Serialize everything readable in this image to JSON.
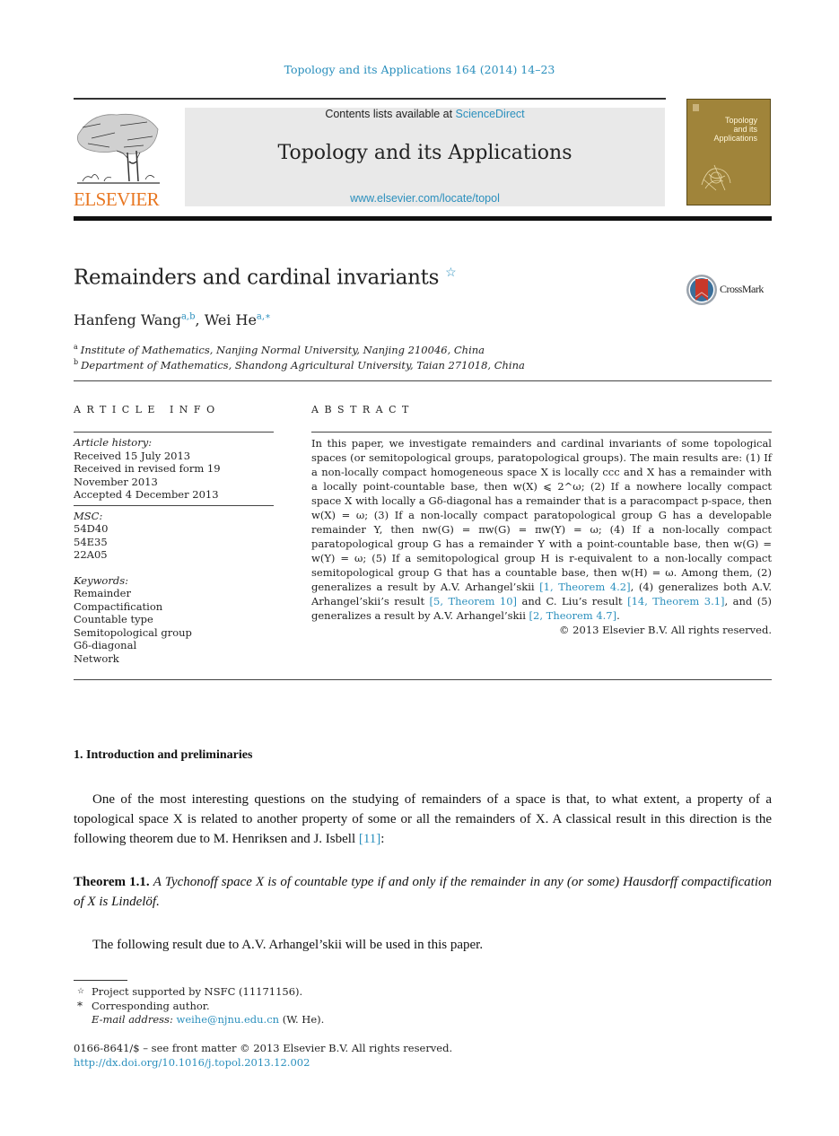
{
  "header": {
    "journal_ref": "Topology and its Applications 164 (2014) 14–23",
    "contents_prefix": "Contents lists available at ",
    "contents_link": "ScienceDirect",
    "journal_title": "Topology and its Applications",
    "journal_url": "www.elsevier.com/locate/topol",
    "publisher_logo_text": "ELSEVIER",
    "cover_title_lines": [
      "Topology",
      "and its",
      "Applications"
    ],
    "crossmark_label": "CrossMark"
  },
  "colors": {
    "link": "#2a8fbd",
    "elsevier_orange": "#e87722",
    "cover_gold": "#a0843a",
    "masthead_gray": "#e9e9e9"
  },
  "article": {
    "title": "Remainders and cardinal invariants",
    "title_mark": "☆",
    "authors": [
      {
        "name": "Hanfeng Wang",
        "marks": "a,b"
      },
      {
        "name": "Wei He",
        "marks": "a,∗"
      }
    ],
    "author_separator": ", ",
    "affiliations": [
      {
        "mark": "a",
        "text": "Institute of Mathematics, Nanjing Normal University, Nanjing 210046, China"
      },
      {
        "mark": "b",
        "text": "Department of Mathematics, Shandong Agricultural University, Taian 271018, China"
      }
    ]
  },
  "article_info": {
    "heading": "ARTICLE INFO",
    "history_label": "Article history:",
    "history": [
      "Received 15 July 2013",
      "Received in revised form 19",
      "November 2013",
      "Accepted 4 December 2013"
    ],
    "msc_label": "MSC:",
    "msc": [
      "54D40",
      "54E35",
      "22A05"
    ],
    "keywords_label": "Keywords:",
    "keywords": [
      "Remainder",
      "Compactification",
      "Countable type",
      "Semitopological group",
      "Gδ-diagonal",
      "Network"
    ]
  },
  "abstract": {
    "heading": "ABSTRACT",
    "text_parts": [
      "In this paper, we investigate remainders and cardinal invariants of some topological spaces (or semitopological groups, paratopological groups). The main results are: (1) If a non-locally compact homogeneous space X is locally ccc and X has a remainder with a locally point-countable base, then w(X) ⩽ 2^ω; (2) If a nowhere locally compact space X with locally a Gδ-diagonal has a remainder that is a paracompact p-space, then w(X) = ω; (3) If a non-locally compact paratopological group G has a developable remainder Y, then nw(G) = πw(G) = πw(Y) = ω; (4) If a non-locally compact paratopological group G has a remainder Y with a point-countable base, then w(G) = w(Y) = ω; (5) If a semitopological group H is r-equivalent to a non-locally compact semitopological group G that has a countable base, then w(H) = ω. Among them, (2) generalizes a result by A.V. Arhangel’skii ",
      "[1, Theorem 4.2]",
      ", (4) generalizes both A.V. Arhangel’skii’s result ",
      "[5, Theorem 10]",
      " and C. Liu’s result ",
      "[14, Theorem 3.1]",
      ", and (5) generalizes a result by A.V. Arhangel’skii ",
      "[2, Theorem 4.7]",
      "."
    ],
    "copyright": "© 2013 Elsevier B.V. All rights reserved."
  },
  "body": {
    "section_heading": "1.  Introduction and preliminaries",
    "intro_text": "One of the most interesting questions on the studying of remainders of a space is that, to what extent, a property of a topological space X is related to another property of some or all the remainders of X. A classical result in this direction is the following theorem due to M. Henriksen and J. Isbell ",
    "intro_ref": "[11]",
    "intro_end": ":",
    "theorem_label": "Theorem 1.1.",
    "theorem_text": "A Tychonoff space X is of countable type if and only if the remainder in any (or some) Hausdorff compactification of X is Lindelöf.",
    "follow_text": "The following result due to A.V. Arhangel’skii will be used in this paper."
  },
  "footnotes": {
    "star_mark": "☆",
    "star_text": "Project supported by NSFC (11171156).",
    "corr_mark": "*",
    "corr_text": "Corresponding author.",
    "email_label": "E-mail address:",
    "email": "weihe@njnu.edu.cn",
    "email_suffix": " (W. He)."
  },
  "front_matter": {
    "issn_line": "0166-8641/$ – see front matter  © 2013 Elsevier B.V. All rights reserved.",
    "doi": "http://dx.doi.org/10.1016/j.topol.2013.12.002"
  }
}
